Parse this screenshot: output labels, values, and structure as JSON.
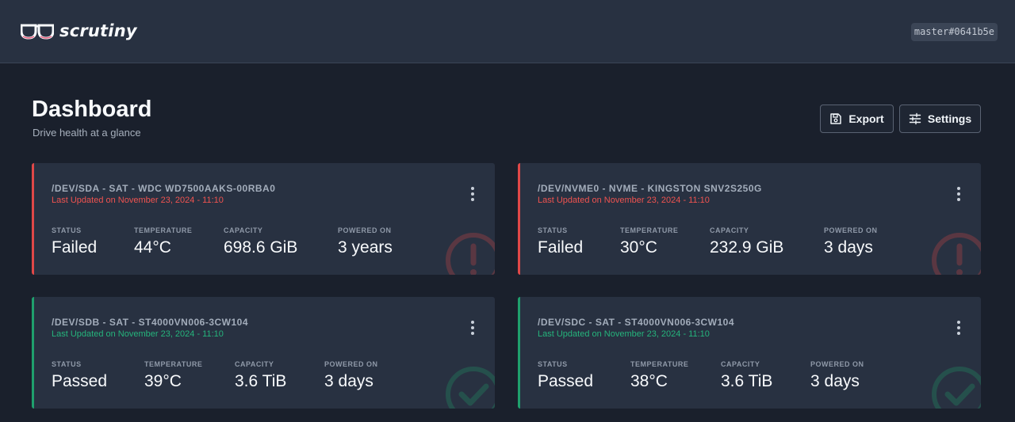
{
  "header": {
    "app_name": "scrutiny",
    "version": "master#0641b5e"
  },
  "page": {
    "title": "Dashboard",
    "subtitle": "Drive health at a glance"
  },
  "actions": {
    "export_label": "Export",
    "settings_label": "Settings"
  },
  "stat_labels": {
    "status": "STATUS",
    "temperature": "TEMPERATURE",
    "capacity": "CAPACITY",
    "powered_on": "POWERED ON"
  },
  "colors": {
    "failed": "#e04848",
    "passed": "#1fa06d",
    "card_bg": "#283141",
    "page_bg": "#1a202c"
  },
  "drives": [
    {
      "title": "/DEV/SDA - SAT - WDC WD7500AAKS-00RBA0",
      "updated": "Last Updated on November 23, 2024 - 11:10",
      "status": "Failed",
      "temperature": "44°C",
      "capacity": "698.6 GiB",
      "powered_on": "3 years",
      "icon": "alert-circle-icon"
    },
    {
      "title": "/DEV/NVME0 - NVME - KINGSTON SNV2S250G",
      "updated": "Last Updated on November 23, 2024 - 11:10",
      "status": "Failed",
      "temperature": "30°C",
      "capacity": "232.9 GiB",
      "powered_on": "3 days",
      "icon": "alert-circle-icon"
    },
    {
      "title": "/DEV/SDB - SAT - ST4000VN006-3CW104",
      "updated": "Last Updated on November 23, 2024 - 11:10",
      "status": "Passed",
      "temperature": "39°C",
      "capacity": "3.6 TiB",
      "powered_on": "3 days",
      "icon": "check-circle-icon"
    },
    {
      "title": "/DEV/SDC - SAT - ST4000VN006-3CW104",
      "updated": "Last Updated on November 23, 2024 - 11:10",
      "status": "Passed",
      "temperature": "38°C",
      "capacity": "3.6 TiB",
      "powered_on": "3 days",
      "icon": "check-circle-icon"
    }
  ]
}
